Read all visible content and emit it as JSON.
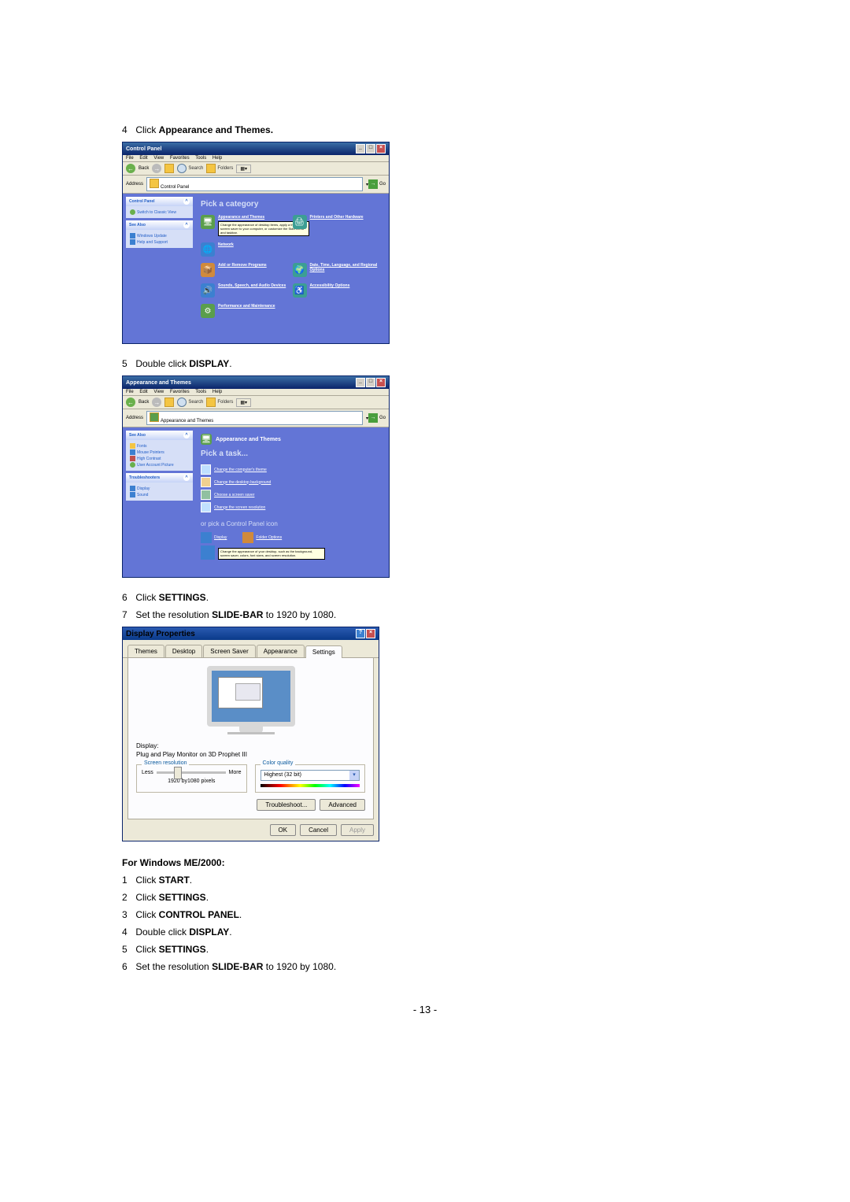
{
  "steps1": {
    "s4": {
      "num": "4",
      "pre": " Click ",
      "bold": "Appearance and Themes."
    }
  },
  "cpwin": {
    "title": "Control Panel",
    "menu": {
      "file": "File",
      "edit": "Edit",
      "view": "View",
      "favorites": "Favorites",
      "tools": "Tools",
      "help": "Help"
    },
    "toolbar": {
      "back": "Back",
      "search": "Search",
      "folders": "Folders"
    },
    "address": {
      "label": "Address",
      "field": "Control Panel",
      "go": "Go"
    },
    "side_cp": {
      "head": "Control Panel",
      "switch": "Switch to Classic View"
    },
    "side_see": {
      "head": "See Also",
      "win_update": "Windows Update",
      "help_support": "Help and Support"
    },
    "main_title": "Pick a category",
    "cats": {
      "appearance": "Appearance and Themes",
      "printers": "Printers and Other Hardware",
      "tooltip": "Change the appearance of desktop items, apply a theme or screen saver to your computer, or customize the Start menu and taskbar.",
      "network": "Network",
      "add_remove": "Add or Remove Programs",
      "date_time": "Date, Time, Language, and Regional Options",
      "sounds": "Sounds, Speech, and Audio Devices",
      "accessibility": "Accessibility Options",
      "performance": "Performance and Maintenance"
    }
  },
  "steps2": {
    "s5": {
      "num": "5",
      "pre": " Double click ",
      "bold": "DISPLAY",
      "post": "."
    }
  },
  "atwin": {
    "title": "Appearance and Themes",
    "address_field": "Appearance and Themes",
    "side_see": {
      "head": "See Also",
      "fonts": "Fonts",
      "mouse": "Mouse Pointers",
      "hc": "High Contrast",
      "uap": "User Account Picture"
    },
    "side_ts": {
      "head": "Troubleshooters",
      "display": "Display",
      "sound": "Sound"
    },
    "banner": "Appearance and Themes",
    "task_title": "Pick a task...",
    "tasks": {
      "t1": "Change the computer's theme",
      "t2": "Change the desktop background",
      "t3": "Choose a screen saver",
      "t4": "Change the screen resolution"
    },
    "or_text": "or pick a Control Panel icon",
    "display": "Display",
    "folder_opts": "Folder Options",
    "tooltip": "Change the appearance of your desktop, such as the background, screen saver, colors, font sizes, and screen resolution."
  },
  "steps3": {
    "s6": {
      "num": "6",
      "pre": " Click ",
      "bold": "SETTINGS",
      "post": "."
    },
    "s7": {
      "num": "7",
      "pre": " Set the resolution ",
      "bold": "SLIDE-BAR",
      "post": " to 1920 by 1080."
    }
  },
  "dialog": {
    "title": "Display Properties",
    "tabs": {
      "themes": "Themes",
      "desktop": "Desktop",
      "ss": "Screen Saver",
      "app": "Appearance",
      "settings": "Settings"
    },
    "display_label": "Display:",
    "display_text": "Plug and Play Monitor on 3D Prophet III",
    "screen_res": {
      "legend": "Screen resolution",
      "less": "Less",
      "more": "More",
      "value": "1920 by1080 pixels"
    },
    "color_quality": {
      "legend": "Color quality",
      "value": "Highest (32 bit)"
    },
    "troubleshoot": "Troubleshoot...",
    "advanced": "Advanced",
    "ok": "OK",
    "cancel": "Cancel",
    "apply": "Apply"
  },
  "me2000": {
    "head": "For Windows ME/2000:",
    "s1": {
      "num": "1",
      "pre": " Click ",
      "bold": "START",
      "post": "."
    },
    "s2": {
      "num": "2",
      "pre": " Click ",
      "bold": "SETTINGS",
      "post": "."
    },
    "s3": {
      "num": "3",
      "pre": " Click ",
      "bold": "CONTROL PANEL",
      "post": "."
    },
    "s4": {
      "num": "4",
      "pre": " Double click ",
      "bold": "DISPLAY",
      "post": "."
    },
    "s5": {
      "num": "5",
      "pre": " Click ",
      "bold": "SETTINGS",
      "post": "."
    },
    "s6": {
      "num": "6",
      "pre": " Set the resolution ",
      "bold": "SLIDE-BAR",
      "post": " to 1920 by 1080."
    }
  },
  "page_num": "- 13 -"
}
